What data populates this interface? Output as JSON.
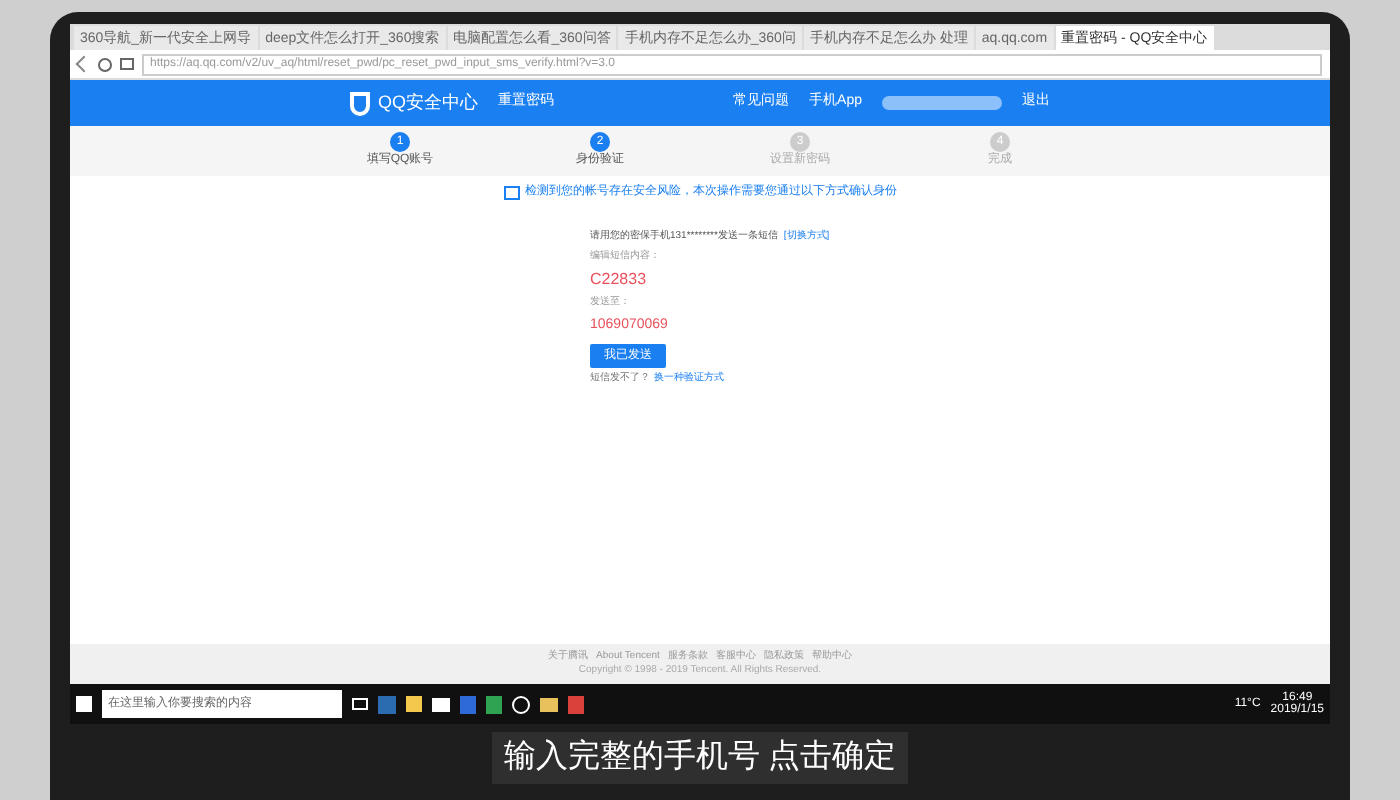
{
  "browser": {
    "tabs": [
      {
        "label": "360导航_新一代安全上网导",
        "selected": false
      },
      {
        "label": "deep文件怎么打开_360搜索",
        "selected": false
      },
      {
        "label": "电脑配置怎么看_360问答",
        "selected": false
      },
      {
        "label": "手机内存不足怎么办_360问",
        "selected": false
      },
      {
        "label": "手机内存不足怎么办 处理",
        "selected": false
      },
      {
        "label": "aq.qq.com",
        "selected": false
      },
      {
        "label": "重置密码 - QQ安全中心",
        "selected": true
      }
    ],
    "address": "https://aq.qq.com/v2/uv_aq/html/reset_pwd/pc_reset_pwd_input_sms_verify.html?v=3.0"
  },
  "header": {
    "logo": "QQ安全中心",
    "page_title": "重置密码",
    "links": [
      "常见问题",
      "手机App"
    ],
    "logout": "退出"
  },
  "steps": [
    {
      "label": "填写QQ账号",
      "number": "1",
      "done": true
    },
    {
      "label": "身份验证",
      "number": "2",
      "done": true
    },
    {
      "label": "设置新密码",
      "number": "3",
      "done": false
    },
    {
      "label": "完成",
      "number": "4",
      "done": false
    }
  ],
  "notice": "检测到您的帐号存在安全风险，本次操作需要您通过以下方式确认身份",
  "verify": {
    "instruction": "请用您的密保手机131********发送一条短信",
    "switch_link": "[切换方式]",
    "content_label": "编辑短信内容：",
    "content": "C22833",
    "to_label": "发送至：",
    "to": "1069070069",
    "button": "我已发送",
    "help": "短信发不了？",
    "help_link": "换一种验证方式"
  },
  "footer": {
    "links": [
      "关于腾讯",
      "About Tencent",
      "服务条款",
      "客服中心",
      "隐私政策",
      "帮助中心"
    ],
    "copyright": "Copyright © 1998 - 2019 Tencent. All Rights Reserved."
  },
  "taskbar": {
    "search_placeholder": "在这里输入你要搜索的内容",
    "temperature": "11°C",
    "time": "16:49",
    "date": "2019/1/15"
  },
  "subtitle": "输入完整的手机号 点击确定"
}
